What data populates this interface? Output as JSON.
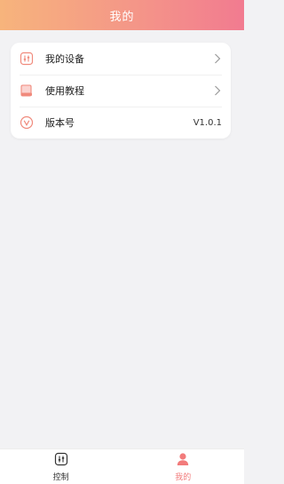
{
  "header": {
    "title": "我的"
  },
  "menu": {
    "items": [
      {
        "label": "我的设备",
        "icon": "device-control-icon",
        "right_type": "chevron"
      },
      {
        "label": "使用教程",
        "icon": "tutorial-book-icon",
        "right_type": "chevron"
      },
      {
        "label": "版本号",
        "icon": "version-icon",
        "right_value": "V1.0.1"
      }
    ]
  },
  "tabbar": {
    "items": [
      {
        "label": "控制",
        "icon": "control-sliders-icon",
        "active": false
      },
      {
        "label": "我的",
        "icon": "user-profile-icon",
        "active": true
      }
    ]
  },
  "colors": {
    "header_gradient_start": "#f7b47c",
    "header_gradient_end": "#f27b90",
    "accent": "#f27b7b",
    "background": "#f2f2f4"
  }
}
